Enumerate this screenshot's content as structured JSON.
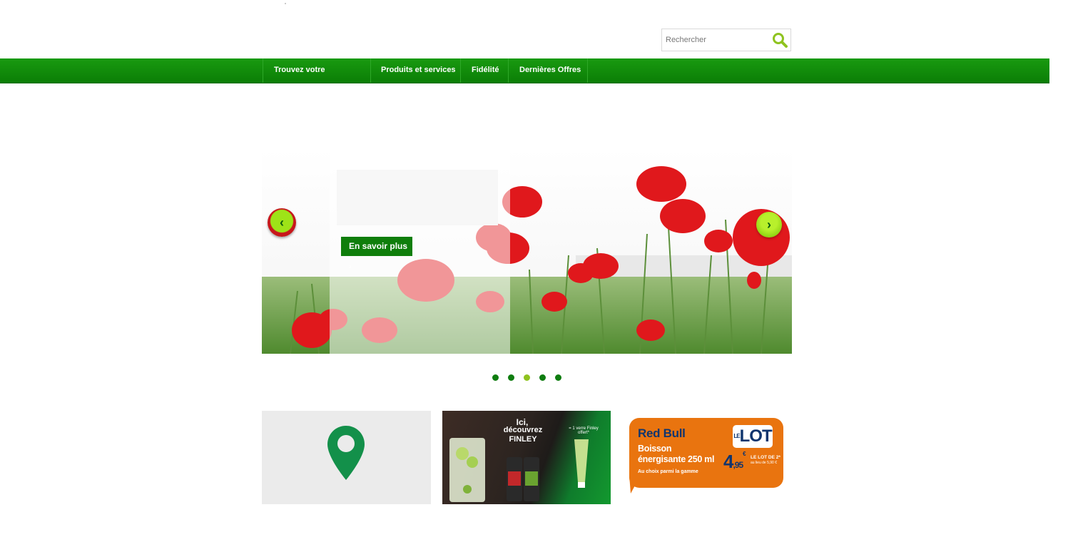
{
  "search": {
    "placeholder": "Rechercher"
  },
  "nav": {
    "items": [
      {
        "label": "Trouvez votre"
      },
      {
        "label": "Produits et services"
      },
      {
        "label": "Fidélité"
      },
      {
        "label": "Dernières Offres"
      }
    ]
  },
  "slider": {
    "cta_label": "En savoir plus",
    "dots_count": 5,
    "active_dot": 3
  },
  "tiles": {
    "finley": {
      "headline_1": "Ici,",
      "headline_2": "découvrez",
      "brand": "FINLEY",
      "offer": "= 1 verre Finley offert*"
    },
    "redbull": {
      "title": "Red Bull",
      "subtitle_1": "Boisson",
      "subtitle_2": "énergisante 250 ml",
      "note": "Au choix parmi la gamme",
      "lot": "LOT",
      "lot_prefix": "LE",
      "price_main": "4",
      "price_decimals": ",95",
      "price_currency": "€",
      "lot_de": "LE LOT DE 2*",
      "au_lieu": "au lieu de 5,90 €"
    }
  },
  "colors": {
    "nav_green": "#0f8a0a",
    "accent_lime": "#8fc31f",
    "cta_green": "#0f7e0b",
    "pin_green": "#13904a",
    "redbull_orange": "#e9740f",
    "redbull_navy": "#10356e"
  },
  "icons": {
    "search": "magnifier-icon",
    "prev": "chevron-left-icon",
    "next": "chevron-right-icon",
    "map": "map-pin-icon"
  }
}
